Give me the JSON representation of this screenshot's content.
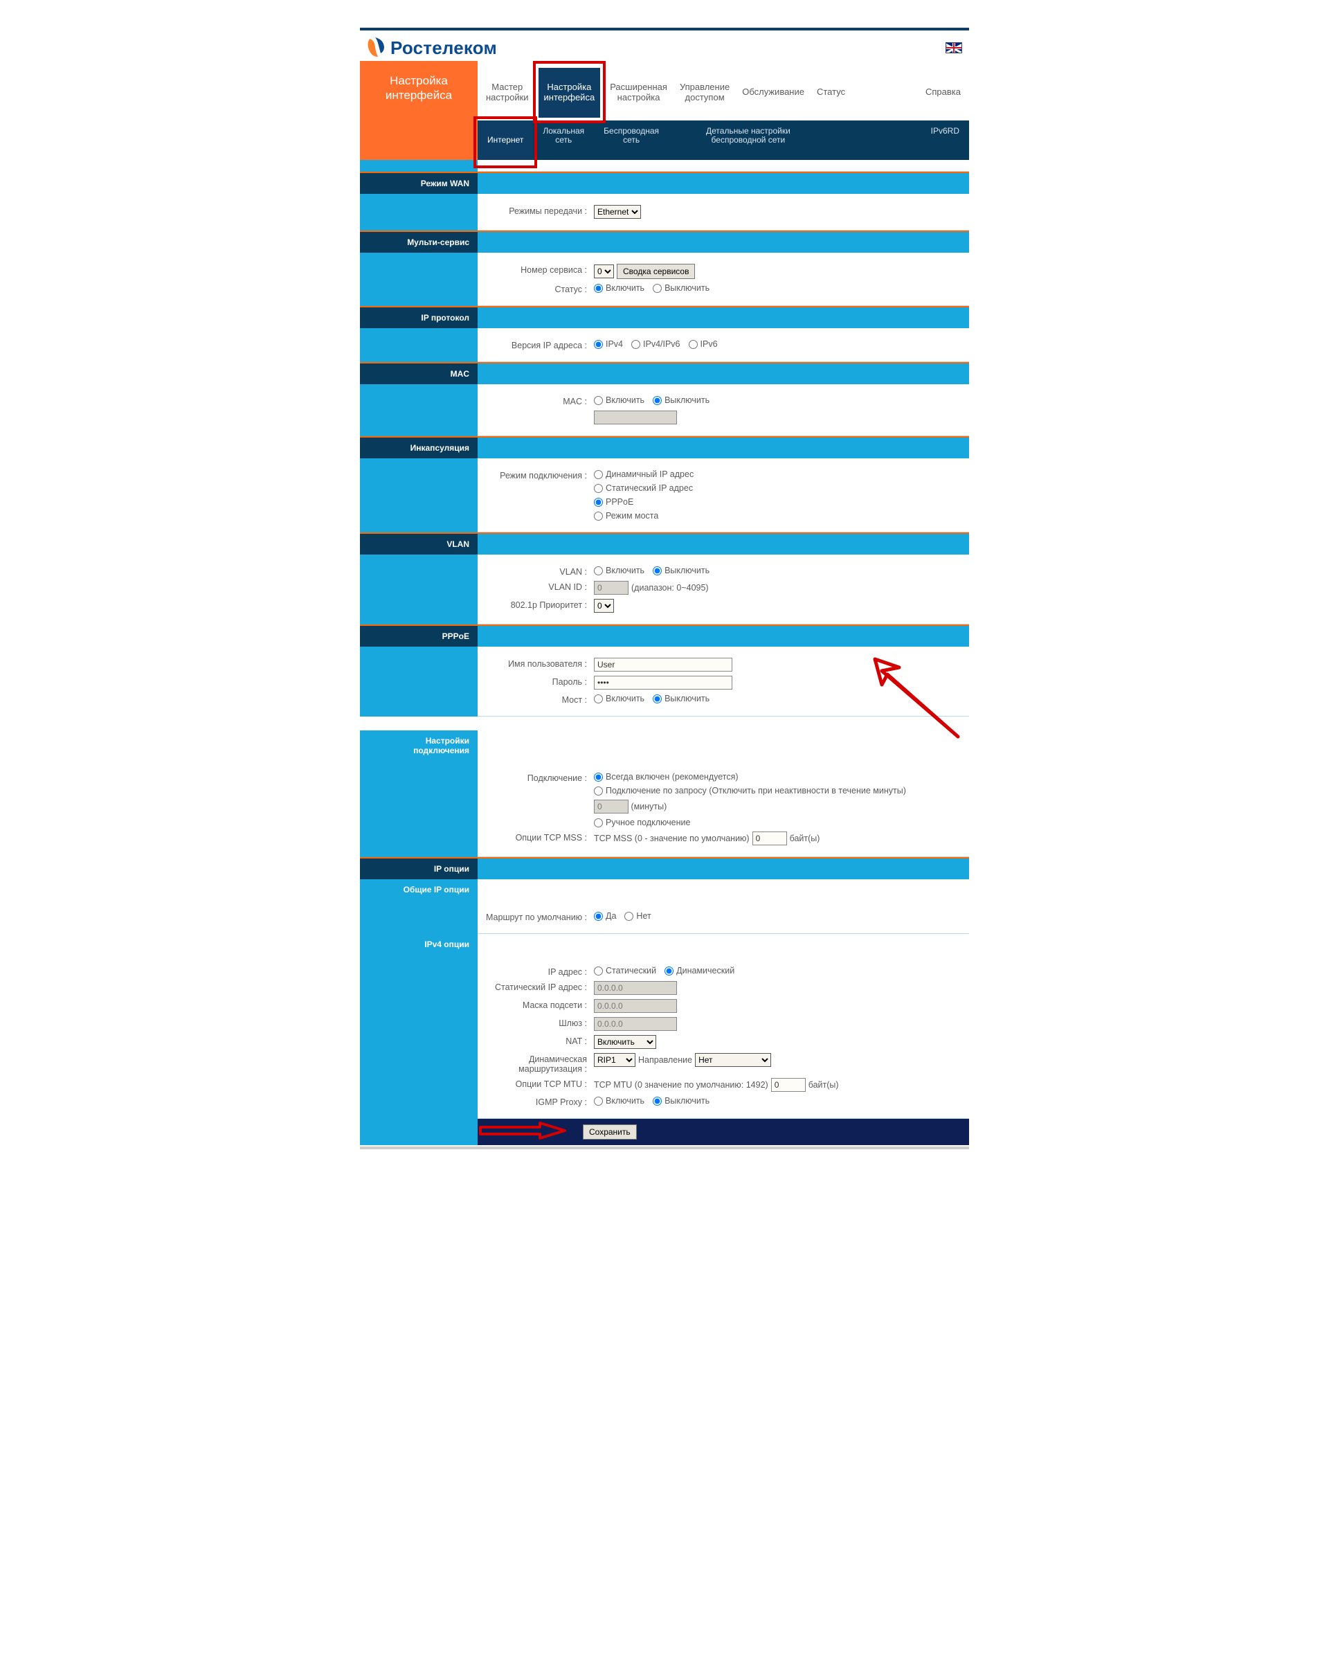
{
  "brand": {
    "name": "Ростелеком",
    "flag_title": "English"
  },
  "side_title": "Настройка интерфейса",
  "topnav": [
    {
      "label": "Мастер\nнастройки"
    },
    {
      "label": "Настройка\nинтерфейса",
      "active": true
    },
    {
      "label": "Расширенная\nнастройка"
    },
    {
      "label": "Управление\nдоступом"
    },
    {
      "label": "Обслуживание"
    },
    {
      "label": "Статус"
    },
    {
      "label": "Справка"
    }
  ],
  "subtabs": [
    {
      "label": "Интернет",
      "active": true
    },
    {
      "label": "Локальная\nсеть"
    },
    {
      "label": "Беспроводная\nсеть"
    },
    {
      "label": "Детальные настройки\nбеспроводной сети"
    },
    {
      "label": "IPv6RD"
    }
  ],
  "sections": {
    "wan": {
      "title": "Режим WAN",
      "transfer_mode_label": "Режимы передачи :",
      "transfer_mode_value": "Ethernet"
    },
    "multi": {
      "title": "Мульти-сервис",
      "service_no_label": "Номер сервиса :",
      "service_no_value": "0",
      "summary_btn": "Сводка сервисов",
      "status_label": "Статус :",
      "status_on": "Включить",
      "status_off": "Выключить"
    },
    "ip_proto": {
      "title": "IP протокол",
      "ipver_label": "Версия IP адреса :",
      "ipver_opts": [
        "IPv4",
        "IPv4/IPv6",
        "IPv6"
      ]
    },
    "mac": {
      "title": "MAC",
      "label": "MAC :",
      "on": "Включить",
      "off": "Выключить",
      "value": ""
    },
    "encap": {
      "title": "Инкапсуляция",
      "mode_label": "Режим подключения :",
      "opts": [
        "Динамичный IP адрес",
        "Статический IP адрес",
        "PPPoE",
        "Режим моста"
      ]
    },
    "vlan": {
      "title": "VLAN",
      "label": "VLAN :",
      "on": "Включить",
      "off": "Выключить",
      "id_label": "VLAN ID :",
      "id_value": "0",
      "id_hint": "(диапазон: 0~4095)",
      "prio_label": "802.1p Приоритет :",
      "prio_value": "0"
    },
    "pppoe": {
      "title": "PPPoE",
      "user_label": "Имя пользователя :",
      "user_value": "User",
      "pass_label": "Пароль :",
      "pass_value": "••••",
      "bridge_label": "Мост :",
      "on": "Включить",
      "off": "Выключить"
    },
    "conn": {
      "title": "Настройки подключения",
      "conn_label": "Подключение :",
      "always": "Всегда включен (рекомендуется)",
      "ondemand": "Подключение по запросу (Отключить при неактивности в течение минуты)",
      "ondemand_value": "0",
      "ondemand_unit": "(минуты)",
      "manual": "Ручное подключение",
      "mss_label": "Опции TCP MSS :",
      "mss_text": "TCP MSS (0 - значение по умолчанию)",
      "mss_value": "0",
      "mss_unit": "байт(ы)"
    },
    "ipopt": {
      "title": "IP опции",
      "common_title": "Общие IP опции",
      "defroute_label": "Маршрут по умолчанию :",
      "yes": "Да",
      "no": "Нет",
      "ipv4_title": "IPv4 опции",
      "ipaddr_label": "IP адрес :",
      "ip_static": "Статический",
      "ip_dynamic": "Динамический",
      "static_ip_label": "Статический IP адрес :",
      "static_ip_value": "0.0.0.0",
      "mask_label": "Маска подсети :",
      "mask_value": "0.0.0.0",
      "gw_label": "Шлюз :",
      "gw_value": "0.0.0.0",
      "nat_label": "NAT :",
      "nat_value": "Включить",
      "dynroute_label": "Динамическая\nмаршрутизация :",
      "dynroute_value": "RIP1",
      "dir_label": "Направление",
      "dir_value": "Нет",
      "mtu_label": "Опции TCP MTU :",
      "mtu_text": "TCP MTU (0 значение по умолчанию: 1492)",
      "mtu_value": "0",
      "mtu_unit": "байт(ы)",
      "igmp_label": "IGMP Proxy :",
      "on": "Включить",
      "off": "Выключить"
    }
  },
  "save_label": "Сохранить"
}
